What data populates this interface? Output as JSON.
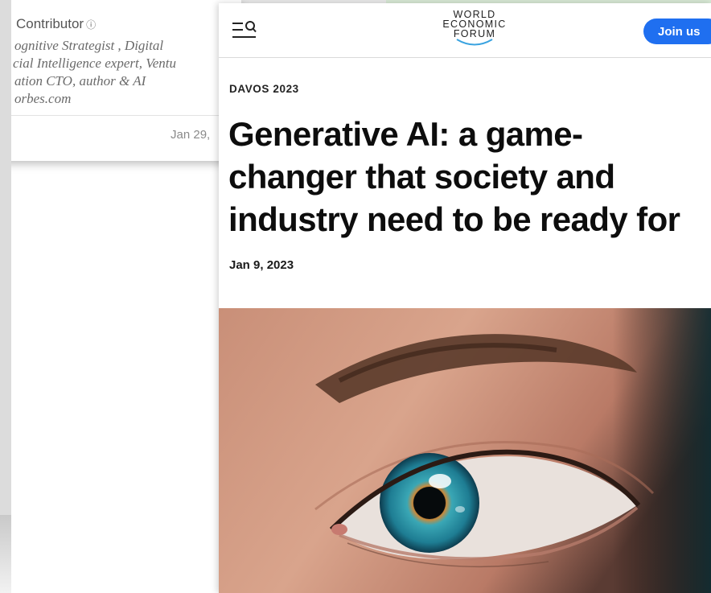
{
  "background_card": {
    "contributor_label": "Contributor",
    "bio_lines": [
      "ognitive Strategist ,  Digital",
      "cial Intelligence expert, Ventu",
      "ation CTO,  author & AI",
      "orbes.com"
    ],
    "date": "Jan 29,"
  },
  "header": {
    "logo_lines": [
      "WORLD",
      "ECONOMIC",
      "FORUM"
    ],
    "join_label": "Join us"
  },
  "article": {
    "kicker": "DAVOS 2023",
    "headline_lines": [
      "Generative AI: a game-",
      "changer that society and",
      "industry need to be ready for"
    ],
    "date": "Jan 9, 2023"
  },
  "colors": {
    "accent": "#1f6ff0",
    "logo_swoosh": "#3aa3e0",
    "iris": "#1e8aa0"
  },
  "icons": {
    "menu_search": "menu-search-icon",
    "contributor_info": "info-icon"
  }
}
